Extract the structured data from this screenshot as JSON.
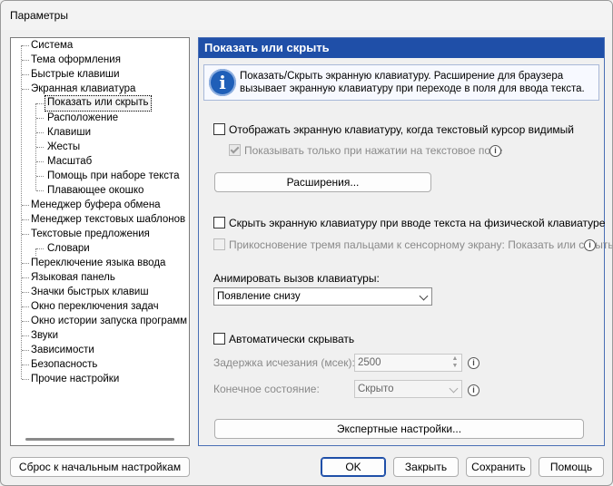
{
  "window": {
    "title": "Параметры"
  },
  "tree": {
    "items": [
      "Система",
      "Тема оформления",
      "Быстрые клавиши",
      "Экранная клавиатура",
      "Показать или скрыть",
      "Расположение",
      "Клавиши",
      "Жесты",
      "Масштаб",
      "Помощь при наборе текста",
      "Плавающее окошко",
      "Менеджер буфера обмена",
      "Менеджер текстовых шаблонов",
      "Текстовые предложения",
      "Словари",
      "Переключение языка ввода",
      "Языковая панель",
      "Значки быстрых клавиш",
      "Окно переключения задач",
      "Окно истории запуска программ",
      "Звуки",
      "Зависимости",
      "Безопасность",
      "Прочие настройки"
    ],
    "selected": "Показать или скрыть"
  },
  "panel": {
    "header": "Показать или скрыть",
    "info": "Показать/Скрыть экранную клавиатуру. Расширение для браузера вызывает экранную клавиатуру при переходе в поля для ввода текста.",
    "cb_show_when_cursor": "Отображать экранную клавиатуру, когда текстовый курсор видимый",
    "cb_show_on_tap": "Показывать только при нажатии на текстовое поле",
    "btn_extensions": "Расширения...",
    "cb_hide_on_physical": "Скрыть экранную клавиатуру при вводе текста на физической клавиатуре",
    "cb_three_finger": "Прикосновение тремя пальцами к сенсорному экрану: Показать или скрыть",
    "animate_label": "Анимировать вызов клавиатуры:",
    "animate_value": "Появление снизу",
    "cb_auto_hide": "Автоматически скрывать",
    "fade_delay_label": "Задержка исчезания (мсек):",
    "fade_delay_value": "2500",
    "final_state_label": "Конечное состояние:",
    "final_state_value": "Скрыто",
    "btn_expert": "Экспертные настройки..."
  },
  "footer": {
    "reset": "Сброс к начальным настройкам",
    "ok": "OK",
    "close": "Закрыть",
    "save": "Сохранить",
    "help": "Помощь"
  },
  "help_glyph": "i",
  "icons": [
    "info-icon",
    "help-icon",
    "checkbox-check-icon",
    "chevron-down-icon"
  ]
}
